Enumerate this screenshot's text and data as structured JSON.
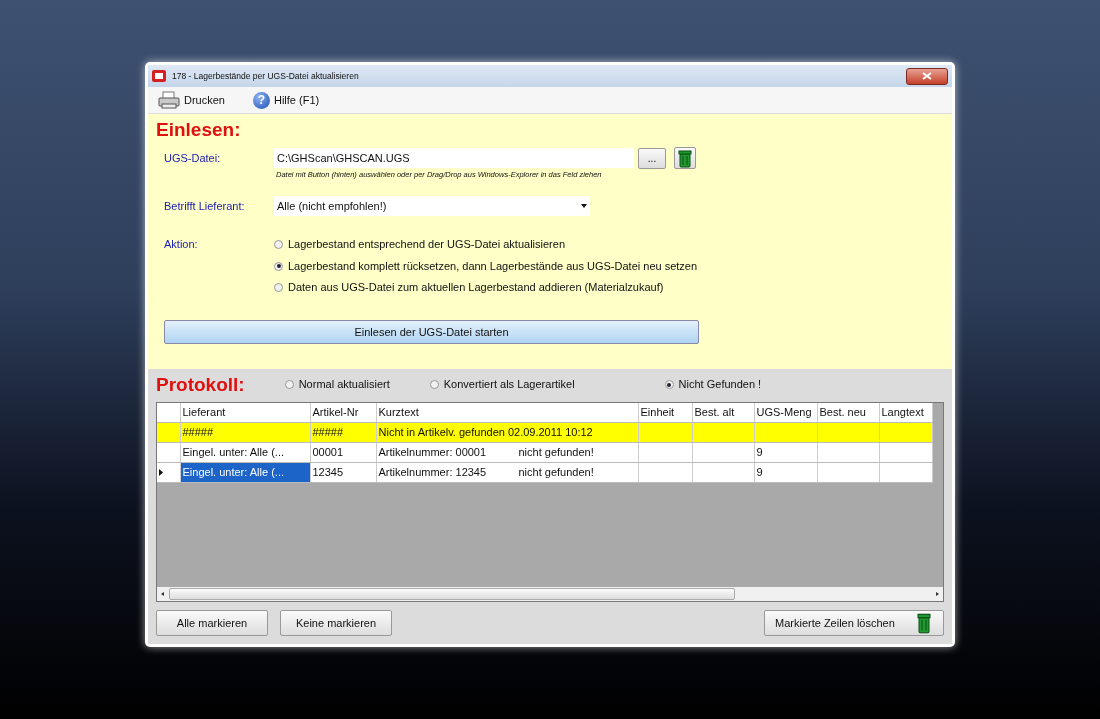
{
  "window": {
    "title": "178  -  Lagerbestände per UGS-Datei aktualisieren"
  },
  "toolbar": [
    {
      "kind": "print",
      "label": "Drucken"
    },
    {
      "kind": "help",
      "label": "Hilfe (F1)",
      "glyph": "?"
    }
  ],
  "einlesen": {
    "heading": "Einlesen:",
    "file": {
      "label": "UGS-Datei:",
      "value": "C:\\GHScan\\GHSCAN.UGS",
      "browse": "...",
      "hint": "Datei mit Button (hinten) auswählen oder per Drag/Drop aus Windows-Explorer in das Feld ziehen"
    },
    "supplier": {
      "label": "Betrifft Lieferant:",
      "value": "Alle (nicht empfohlen!)"
    },
    "action": {
      "label": "Aktion:",
      "options": [
        {
          "label": "Lagerbestand entsprechend der UGS-Datei aktualisieren",
          "selected": false
        },
        {
          "label": "Lagerbestand komplett rücksetzen, dann Lagerbestände aus UGS-Datei neu setzen",
          "selected": true
        },
        {
          "label": "Daten aus UGS-Datei zum aktuellen Lagerbestand addieren (Materialzukauf)",
          "selected": false
        }
      ]
    },
    "start_button": "Einlesen der UGS-Datei starten"
  },
  "protokoll": {
    "heading": "Protokoll:",
    "filters": [
      {
        "label": "Normal aktualisiert",
        "selected": false
      },
      {
        "label": "Konvertiert als Lagerartikel",
        "selected": false
      },
      {
        "label": "Nicht Gefunden !",
        "selected": true
      }
    ],
    "table": {
      "columns": [
        "Lieferant",
        "Artikel-Nr",
        "Kurztext",
        "Einheit",
        "Best. alt",
        "UGS-Meng",
        "Best. neu",
        "Langtext"
      ],
      "rows": [
        {
          "highlighted": true,
          "current": false,
          "selected": false,
          "cells": [
            "#####",
            "#####",
            [
              "Nicht in Artikelv. gefunden  02.09.2011 10:12"
            ],
            "",
            "",
            "",
            "",
            ""
          ]
        },
        {
          "highlighted": false,
          "current": false,
          "selected": false,
          "cells": [
            "Eingel. unter: Alle (...",
            "00001",
            [
              "Artikelnummer: 00001",
              "nicht gefunden!"
            ],
            "",
            "",
            "9",
            "",
            ""
          ]
        },
        {
          "highlighted": false,
          "current": true,
          "selected": true,
          "cells": [
            "Eingel. unter: Alle (...",
            "12345",
            [
              "Artikelnummer: 12345",
              "nicht gefunden!"
            ],
            "",
            "",
            "9",
            "",
            ""
          ]
        }
      ]
    },
    "buttons": [
      "Alle markieren",
      "Keine markieren"
    ],
    "delete_button": "Markierte Zeilen löschen"
  }
}
